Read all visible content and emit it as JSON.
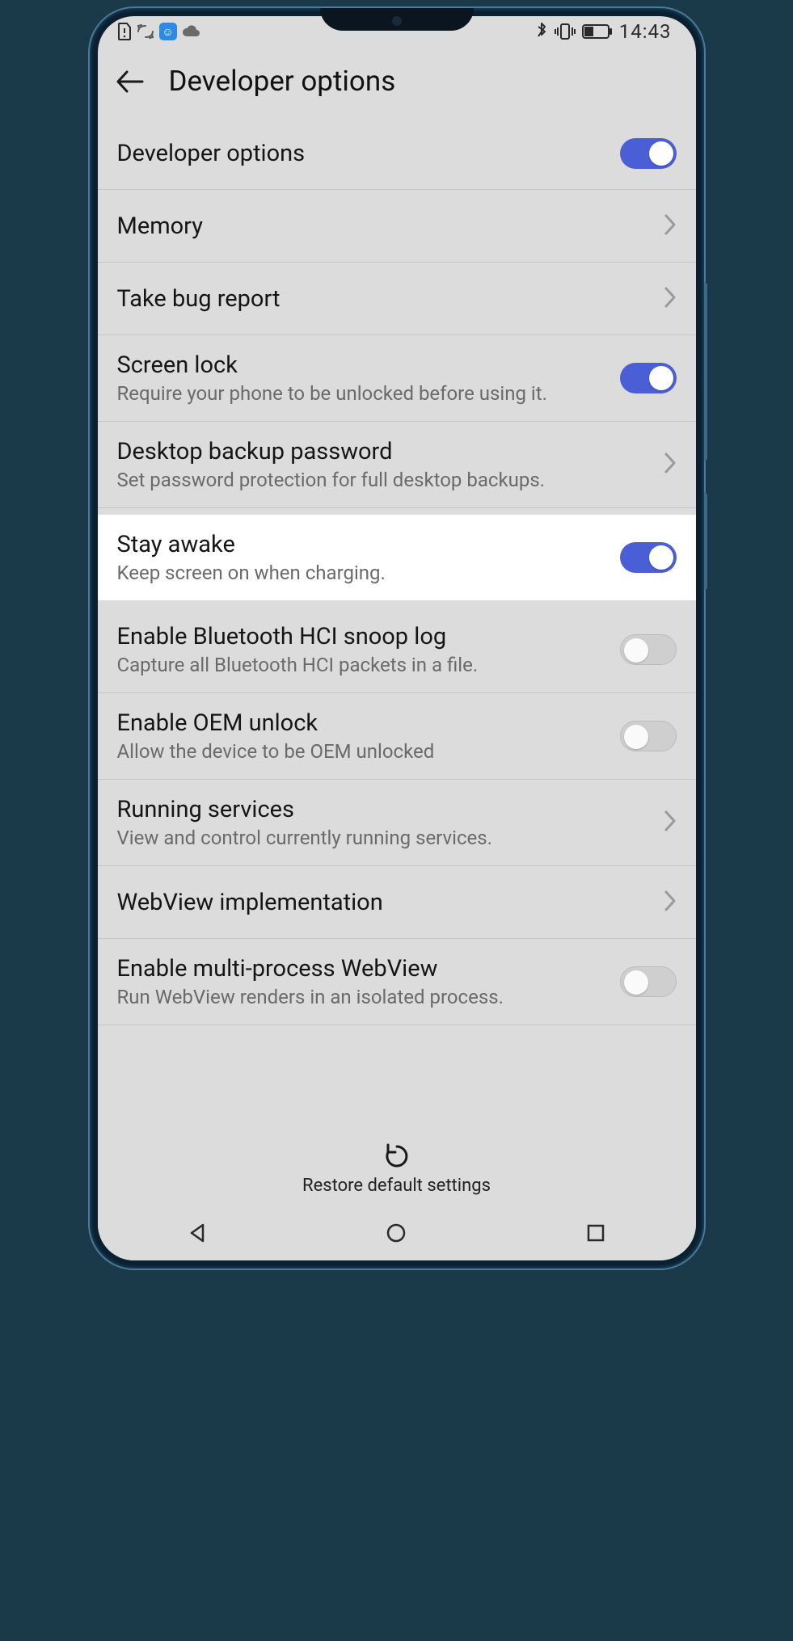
{
  "status": {
    "time": "14:43"
  },
  "header": {
    "title": "Developer options"
  },
  "rows": {
    "dev_options": {
      "title": "Developer options"
    },
    "memory": {
      "title": "Memory"
    },
    "bug_report": {
      "title": "Take bug report"
    },
    "screen_lock": {
      "title": "Screen lock",
      "sub": "Require your phone to be unlocked before using it."
    },
    "backup_pwd": {
      "title": "Desktop backup password",
      "sub": "Set password protection for full desktop backups."
    },
    "stay_awake": {
      "title": "Stay awake",
      "sub": "Keep screen on when charging."
    },
    "bt_snoop": {
      "title": "Enable Bluetooth HCI snoop log",
      "sub": "Capture all Bluetooth HCI packets in a file."
    },
    "oem_unlock": {
      "title": "Enable OEM unlock",
      "sub": "Allow the device to be OEM unlocked"
    },
    "running_svc": {
      "title": "Running services",
      "sub": "View and control currently running services."
    },
    "webview_impl": {
      "title": "WebView implementation"
    },
    "multi_webview": {
      "title": "Enable multi-process WebView",
      "sub": "Run WebView renders in an isolated process."
    }
  },
  "toggles": {
    "dev_options": true,
    "screen_lock": true,
    "stay_awake": true,
    "bt_snoop": false,
    "oem_unlock": false,
    "multi_webview": false
  },
  "bottom": {
    "restore": "Restore default settings"
  },
  "colors": {
    "accent": "#4a5fd6",
    "bg": "#dcdcdc",
    "text_secondary": "#6a6a6a"
  }
}
